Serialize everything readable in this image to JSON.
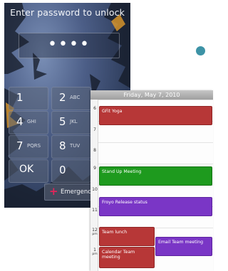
{
  "lock_screen": {
    "title": "Enter password to unlock",
    "password_mask": "••••",
    "keys": [
      {
        "num": "1",
        "letters": ""
      },
      {
        "num": "2",
        "letters": "ABC"
      },
      {
        "num": "4",
        "letters": "GHI"
      },
      {
        "num": "5",
        "letters": "JKL"
      },
      {
        "num": "7",
        "letters": "PQRS"
      },
      {
        "num": "8",
        "letters": "TUV"
      },
      {
        "num": "OK",
        "letters": ""
      },
      {
        "num": "0",
        "letters": ""
      }
    ],
    "emergency_label": "Emergency ca"
  },
  "calendar": {
    "date": "Friday, May 7, 2010",
    "hours": [
      {
        "h": "6",
        "suffix": ""
      },
      {
        "h": "7",
        "suffix": ""
      },
      {
        "h": "8",
        "suffix": ""
      },
      {
        "h": "9",
        "suffix": ""
      },
      {
        "h": "10",
        "suffix": ""
      },
      {
        "h": "11",
        "suffix": ""
      },
      {
        "h": "12",
        "suffix": "pm"
      },
      {
        "h": "1",
        "suffix": "pm"
      }
    ],
    "events": [
      {
        "title": "GFit Yoga",
        "color": "#b73737"
      },
      {
        "title": "Stand Up Meeting",
        "color": "#1e9a1e"
      },
      {
        "title": "Froyo Release status",
        "color": "#7a36c6"
      },
      {
        "title": "Team lunch",
        "color": "#b73737"
      },
      {
        "title": "Email Team meeting",
        "color": "#7a36c6"
      },
      {
        "title": "Calendar Team meeting",
        "color": "#b73737"
      }
    ]
  },
  "decoration": {
    "dot_color": "#3d93a6"
  }
}
